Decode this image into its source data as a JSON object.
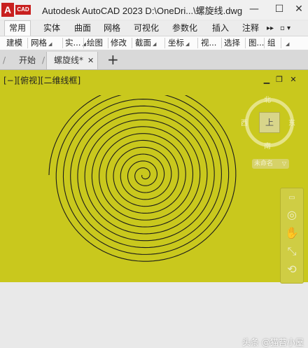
{
  "app": {
    "logo_letter": "A",
    "logo_text": "CAD",
    "title": "Autodesk AutoCAD 2023    D:\\OneDri...\\螺旋线.dwg"
  },
  "window_controls": {
    "minimize": "—",
    "maximize": "☐",
    "close": "✕"
  },
  "ribbon_tabs": [
    "常用",
    "实体",
    "曲面",
    "网格",
    "可视化",
    "参数化",
    "插入",
    "注释"
  ],
  "ribbon_more": "▸▸",
  "ribbon_toggle": "▫ ▾",
  "ribbon_panels": [
    {
      "label": "建模",
      "arrow": false
    },
    {
      "label": "网格",
      "arrow": true
    },
    {
      "label": "实...",
      "arrow": true
    },
    {
      "label": "绘图",
      "arrow": false
    },
    {
      "label": "修改",
      "arrow": false
    },
    {
      "label": "截面",
      "arrow": true
    },
    {
      "label": "坐标",
      "arrow": true
    },
    {
      "label": "视...",
      "arrow": false
    },
    {
      "label": "选择",
      "arrow": false
    },
    {
      "label": "图...",
      "arrow": false
    },
    {
      "label": "组",
      "arrow": false
    },
    {
      "label": "",
      "arrow": true
    }
  ],
  "file_tabs": {
    "start": "开始",
    "active": "螺旋线*",
    "close": "✕",
    "add": "+"
  },
  "viewport": {
    "label": "[−][俯视][二维线框]",
    "controls": {
      "minimize": "▁",
      "restore": "❐",
      "close": "✕"
    },
    "background": "#c9c81d",
    "spiral_color": "#1a1a1a"
  },
  "viewcube": {
    "north": "北",
    "south": "南",
    "west": "西",
    "east": "东",
    "face": "上",
    "ucs": "未命名"
  },
  "watermark": "头条 @猫苔小屋"
}
